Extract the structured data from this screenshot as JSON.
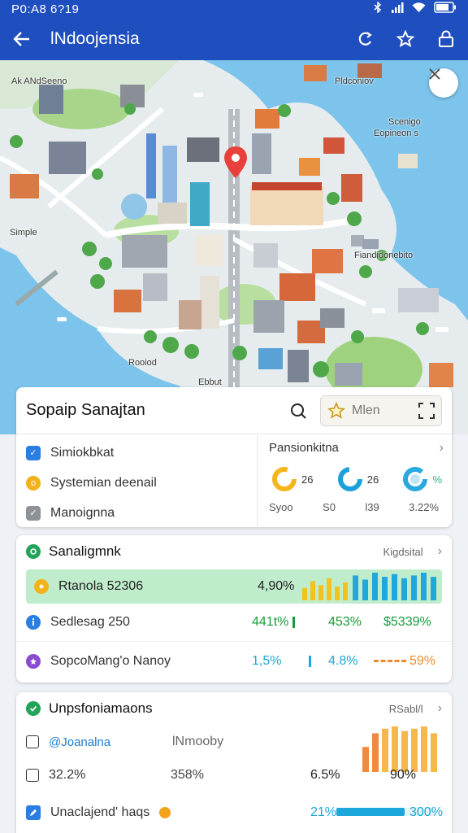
{
  "status": {
    "time": "P0:A8 6?19"
  },
  "appbar": {
    "title": "lNdoojensia"
  },
  "map": {
    "labels": [
      "Ak ANdSeeno",
      "Pldconiov",
      "Scenigo",
      "Eopineon s",
      "Simple",
      "Fiandidonebito",
      "Rooiod",
      "Ebbut"
    ],
    "pin_color": "#e8413c",
    "water_color": "#7cc4ec",
    "land_color": "#e9eef0"
  },
  "card1": {
    "title": "Sopaip Sanajtan",
    "search_placeholder": "Mlen",
    "items": [
      "Simiokbkat",
      "Systemian deenail",
      "Manoignna"
    ],
    "right_title": "Pansionkitna",
    "gauges": [
      {
        "value": "26",
        "label": "Syoo",
        "color": "#f5b51c"
      },
      {
        "value": "26",
        "label": "S0",
        "color": "#1aa0dc"
      },
      {
        "value": "%",
        "label": "l39",
        "color": "#28a9e0"
      }
    ],
    "gauge_extra": "3.22%"
  },
  "card2": {
    "title": "Sanaligmnk",
    "link": "Kigdsital",
    "highlight": {
      "label": "Rtanola 52306",
      "value": "4,90%"
    },
    "rows": [
      {
        "label": "Sedlesag 250",
        "v1": "441t%",
        "v2": "453%",
        "v3": "$5339%"
      },
      {
        "label": "SopcoMang'o Nanoy",
        "v1": "1,5%",
        "v2": "4.8%",
        "v3": "59%"
      }
    ],
    "bars_yellow": [
      0.45,
      0.7,
      0.55,
      0.8,
      0.5,
      0.65
    ],
    "bars_blue": [
      0.9,
      0.75,
      1.0,
      0.85,
      0.95,
      0.8,
      0.9,
      1.0,
      0.85
    ]
  },
  "card3": {
    "title": "Unpsfoniamaons",
    "link": "RSabl/l",
    "sub_left": "@Joanalna",
    "sub_mid": "lNmooby",
    "rows": [
      {
        "label": "32.2%",
        "mid": "358%",
        "right1": "6.5%",
        "right2": "90%"
      },
      {
        "label": "Unaclajend' haqs",
        "right1": "21%",
        "right2": "300%"
      }
    ],
    "bars_orange": [
      0.55,
      0.85,
      0.95,
      1.0,
      0.9,
      0.95,
      1.0,
      0.85
    ],
    "progress": 0.7
  }
}
